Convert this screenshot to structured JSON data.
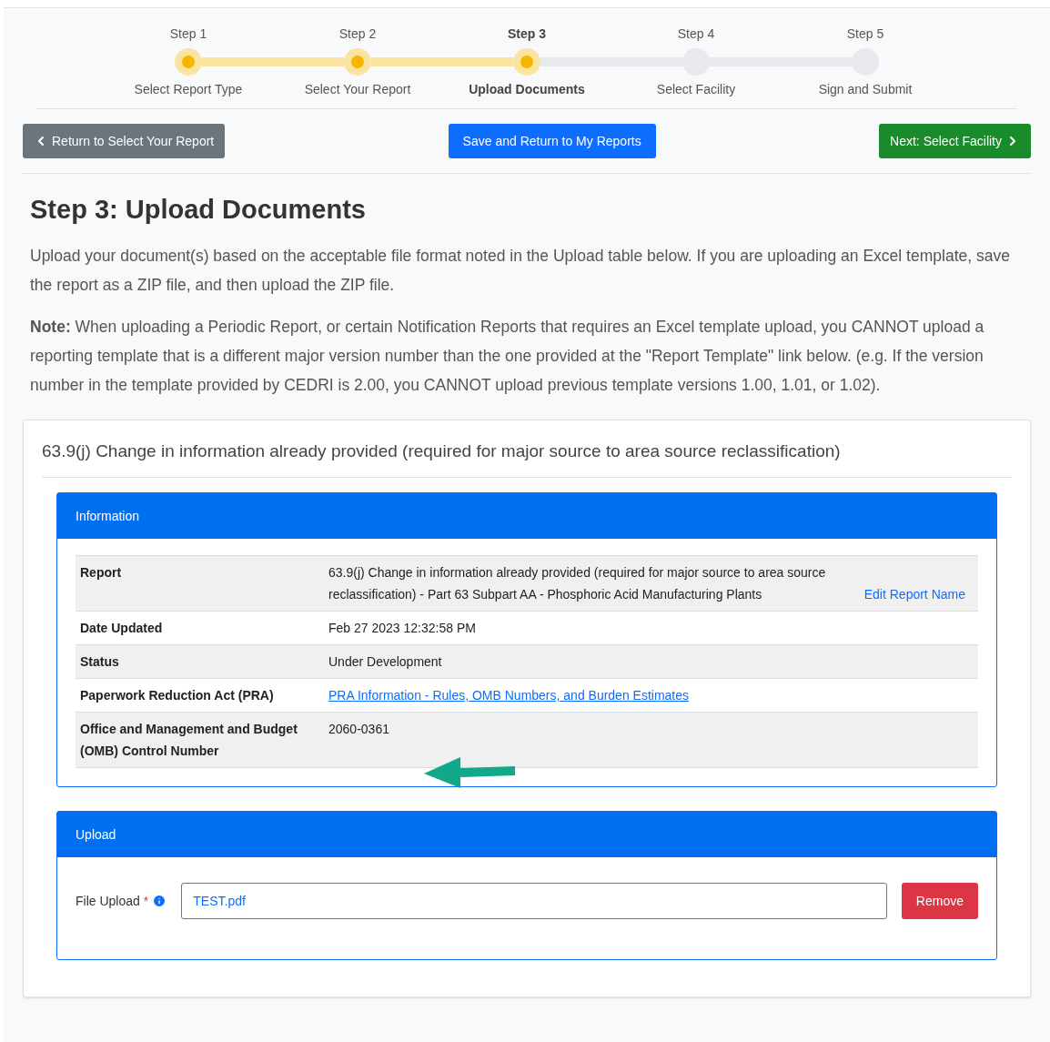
{
  "steps": [
    {
      "number": "Step 1",
      "label": "Select Report Type",
      "completed": true,
      "selected": false
    },
    {
      "number": "Step 2",
      "label": "Select Your Report",
      "completed": true,
      "selected": false
    },
    {
      "number": "Step 3",
      "label": "Upload Documents",
      "completed": true,
      "selected": true
    },
    {
      "number": "Step 4",
      "label": "Select Facility",
      "completed": false,
      "selected": false
    },
    {
      "number": "Step 5",
      "label": "Sign and Submit",
      "completed": false,
      "selected": false
    }
  ],
  "nav": {
    "back": "Return to Select Your Report",
    "save": "Save and Return to My Reports",
    "next": "Next: Select Facility"
  },
  "heading": "Step 3: Upload Documents",
  "intro": "Upload your document(s) based on the acceptable file format noted in the Upload table below. If you are uploading an Excel template, save the report as a ZIP file, and then upload the ZIP file.",
  "note": "**Note:** When uploading a Periodic Report, or certain Notification Reports that requires an Excel template upload, you CANNOT upload a reporting template that is a different major version number than the one provided at the \"Report Template\" link below. (e.g. If the version number in the template provided by CEDRI is 2.00, you CANNOT upload previous template versions 1.00, 1.01, or 1.02).",
  "card_title": "63.9(j) Change in information already provided (required for major source to area source reclassification)",
  "information": {
    "title": "Information",
    "rows": [
      {
        "label": "Report",
        "kind": "text_action",
        "value": "63.9(j) Change in information already provided (required for major source to area source reclassification) - Part 63 Subpart AA - Phosphoric Acid Manufacturing Plants",
        "action": "Edit Report Name"
      },
      {
        "label": "Date Updated",
        "kind": "text",
        "value": "Feb 27 2023 12:32:58 PM"
      },
      {
        "label": "Status",
        "kind": "text",
        "value": "Under Development"
      },
      {
        "label": "Paperwork Reduction Act (PRA)",
        "kind": "link",
        "value": "PRA Information - Rules, OMB Numbers, and Burden Estimates"
      },
      {
        "label": "Office and Management and Budget (OMB) Control Number",
        "kind": "text",
        "value": "2060-0361"
      }
    ]
  },
  "upload": {
    "title": "Upload",
    "field_label": "File Upload",
    "required_mark": "*",
    "value": "TEST.pdf",
    "remove": "Remove"
  }
}
